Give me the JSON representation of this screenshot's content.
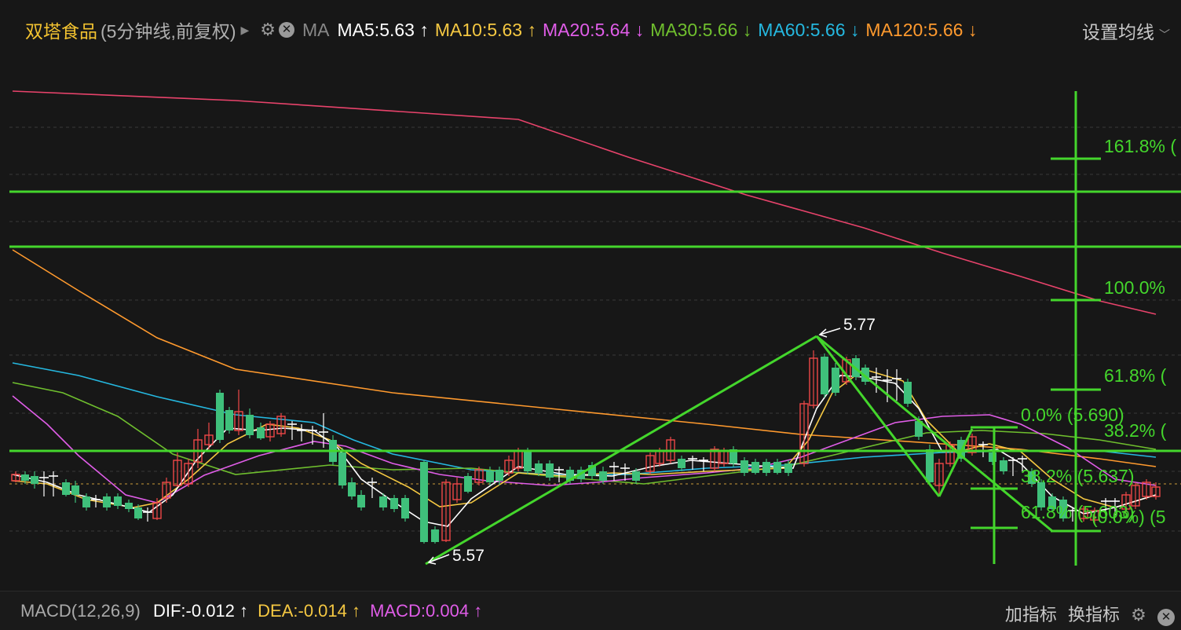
{
  "header": {
    "stock_name": "双塔食品",
    "period": "(5分钟线,前复权)",
    "ma_label": "MA",
    "ma_values": [
      {
        "text": "MA5:5.63",
        "arrow": "↑",
        "color": "#ffffff"
      },
      {
        "text": "MA10:5.63",
        "arrow": "↑",
        "color": "#f5c842"
      },
      {
        "text": "MA20:5.64",
        "arrow": "↓",
        "color": "#e05de8"
      },
      {
        "text": "MA30:5.66",
        "arrow": "↓",
        "color": "#6fbf2e"
      },
      {
        "text": "MA60:5.66",
        "arrow": "↓",
        "color": "#25b8e0"
      },
      {
        "text": "MA120:5.66",
        "arrow": "↓",
        "color": "#ff9a2e"
      }
    ],
    "settings_label": "设置均线",
    "colors": {
      "name": "#f2c230",
      "period": "#b0b0b0"
    }
  },
  "main_chart": {
    "price_annotations": {
      "high": "5.77",
      "low": "5.57"
    },
    "fib_large": [
      "161.8% (",
      "100.0%",
      "61.8%  (",
      "38.2%  ("
    ],
    "fib_small": [
      "0.0%  (5.690)",
      "38.2%  (5.637)",
      "61.8%  (5.603)",
      "(0.0%)  (5"
    ],
    "colors": {
      "up": "#f04848",
      "down": "#3fc07b",
      "drawing": "#44d62c",
      "ma5": "#ffffff",
      "ma10": "#f5c842",
      "ma20": "#e05de8",
      "ma30": "#6fbf2e",
      "ma60": "#25b8e0",
      "ma120": "#ff9a2e",
      "ma250": "#e8436b"
    }
  },
  "macd": {
    "name": "MACD(12,26,9)",
    "dif": "DIF:-0.012",
    "dif_arrow": "↑",
    "dea": "DEA:-0.014",
    "dea_arrow": "↑",
    "macd": "MACD:0.004",
    "macd_arrow": "↑",
    "add_indicator": "加指标",
    "switch_indicator": "换指标"
  }
}
